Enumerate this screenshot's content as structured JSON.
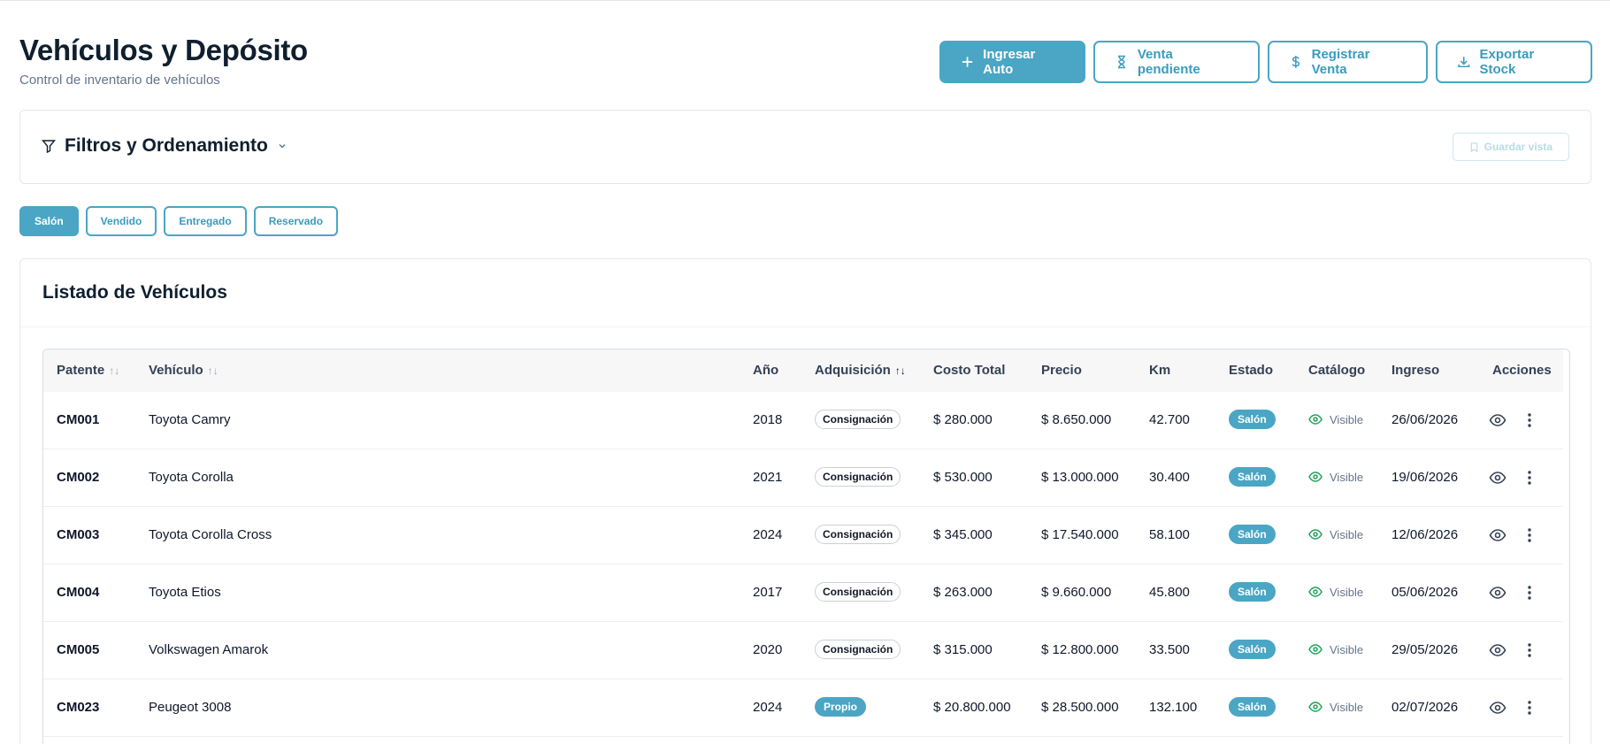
{
  "page": {
    "title": "Vehículos y Depósito",
    "subtitle": "Control de inventario de vehículos"
  },
  "actions": [
    {
      "label": "Ingresar Auto",
      "icon": "plus-icon",
      "primary": true
    },
    {
      "label": "Venta pendiente",
      "icon": "hourglass-icon",
      "primary": false
    },
    {
      "label": "Registrar Venta",
      "icon": "dollar-icon",
      "primary": false
    },
    {
      "label": "Exportar Stock",
      "icon": "download-icon",
      "primary": false
    }
  ],
  "filters": {
    "title": "Filtros y Ordenamiento",
    "save_view_label": "Guardar vista"
  },
  "status_tabs": [
    {
      "label": "Salón",
      "active": true
    },
    {
      "label": "Vendido",
      "active": false
    },
    {
      "label": "Entregado",
      "active": false
    },
    {
      "label": "Reservado",
      "active": false
    }
  ],
  "list": {
    "title": "Listado de Vehículos",
    "columns": [
      "Patente",
      "Vehículo",
      "Año",
      "Adquisición",
      "Costo Total",
      "Precio",
      "Km",
      "Estado",
      "Catálogo",
      "Ingreso",
      "Acciones"
    ],
    "rows": [
      {
        "patente": "CM001",
        "vehiculo": "Toyota Camry",
        "anio": "2018",
        "adquisicion": "Consignación",
        "costo": "$ 280.000",
        "precio": "$ 8.650.000",
        "km": "42.700",
        "estado": "Salón",
        "catalogo": "Visible",
        "ingreso": "26/06/2026"
      },
      {
        "patente": "CM002",
        "vehiculo": "Toyota Corolla",
        "anio": "2021",
        "adquisicion": "Consignación",
        "costo": "$ 530.000",
        "precio": "$ 13.000.000",
        "km": "30.400",
        "estado": "Salón",
        "catalogo": "Visible",
        "ingreso": "19/06/2026"
      },
      {
        "patente": "CM003",
        "vehiculo": "Toyota Corolla Cross",
        "anio": "2024",
        "adquisicion": "Consignación",
        "costo": "$ 345.000",
        "precio": "$ 17.540.000",
        "km": "58.100",
        "estado": "Salón",
        "catalogo": "Visible",
        "ingreso": "12/06/2026"
      },
      {
        "patente": "CM004",
        "vehiculo": "Toyota Etios",
        "anio": "2017",
        "adquisicion": "Consignación",
        "costo": "$ 263.000",
        "precio": "$ 9.660.000",
        "km": "45.800",
        "estado": "Salón",
        "catalogo": "Visible",
        "ingreso": "05/06/2026"
      },
      {
        "patente": "CM005",
        "vehiculo": "Volkswagen Amarok",
        "anio": "2020",
        "adquisicion": "Consignación",
        "costo": "$ 315.000",
        "precio": "$ 12.800.000",
        "km": "33.500",
        "estado": "Salón",
        "catalogo": "Visible",
        "ingreso": "29/05/2026"
      },
      {
        "patente": "CM023",
        "vehiculo": "Peugeot 3008",
        "anio": "2024",
        "adquisicion": "Propio",
        "costo": "$ 20.800.000",
        "precio": "$ 28.500.000",
        "km": "132.100",
        "estado": "Salón",
        "catalogo": "Visible",
        "ingreso": "02/07/2026"
      }
    ]
  },
  "colors": {
    "accent": "#4aa6c4",
    "visible_green": "#22a35a"
  }
}
